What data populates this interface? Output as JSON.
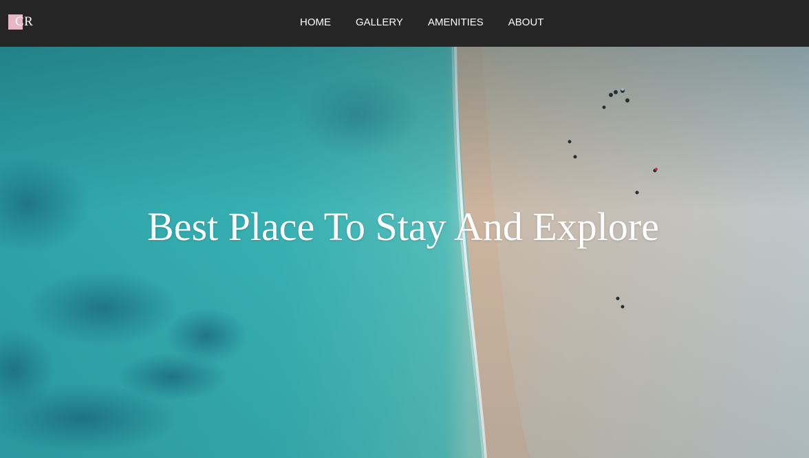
{
  "logo": {
    "text": "NCR",
    "text_suffix": "CR",
    "mark_color": "#e9b7c4"
  },
  "nav": {
    "items": [
      {
        "label": "HOME"
      },
      {
        "label": "GALLERY"
      },
      {
        "label": "AMENITIES"
      },
      {
        "label": "ABOUT"
      }
    ]
  },
  "hero": {
    "title": "Best Place To Stay And Explore",
    "background": "aerial-beach-photo"
  },
  "colors": {
    "navbar": "#262626",
    "sea": "#3bb8b8",
    "sand": "#d9d2c4",
    "text": "#ffffff"
  }
}
